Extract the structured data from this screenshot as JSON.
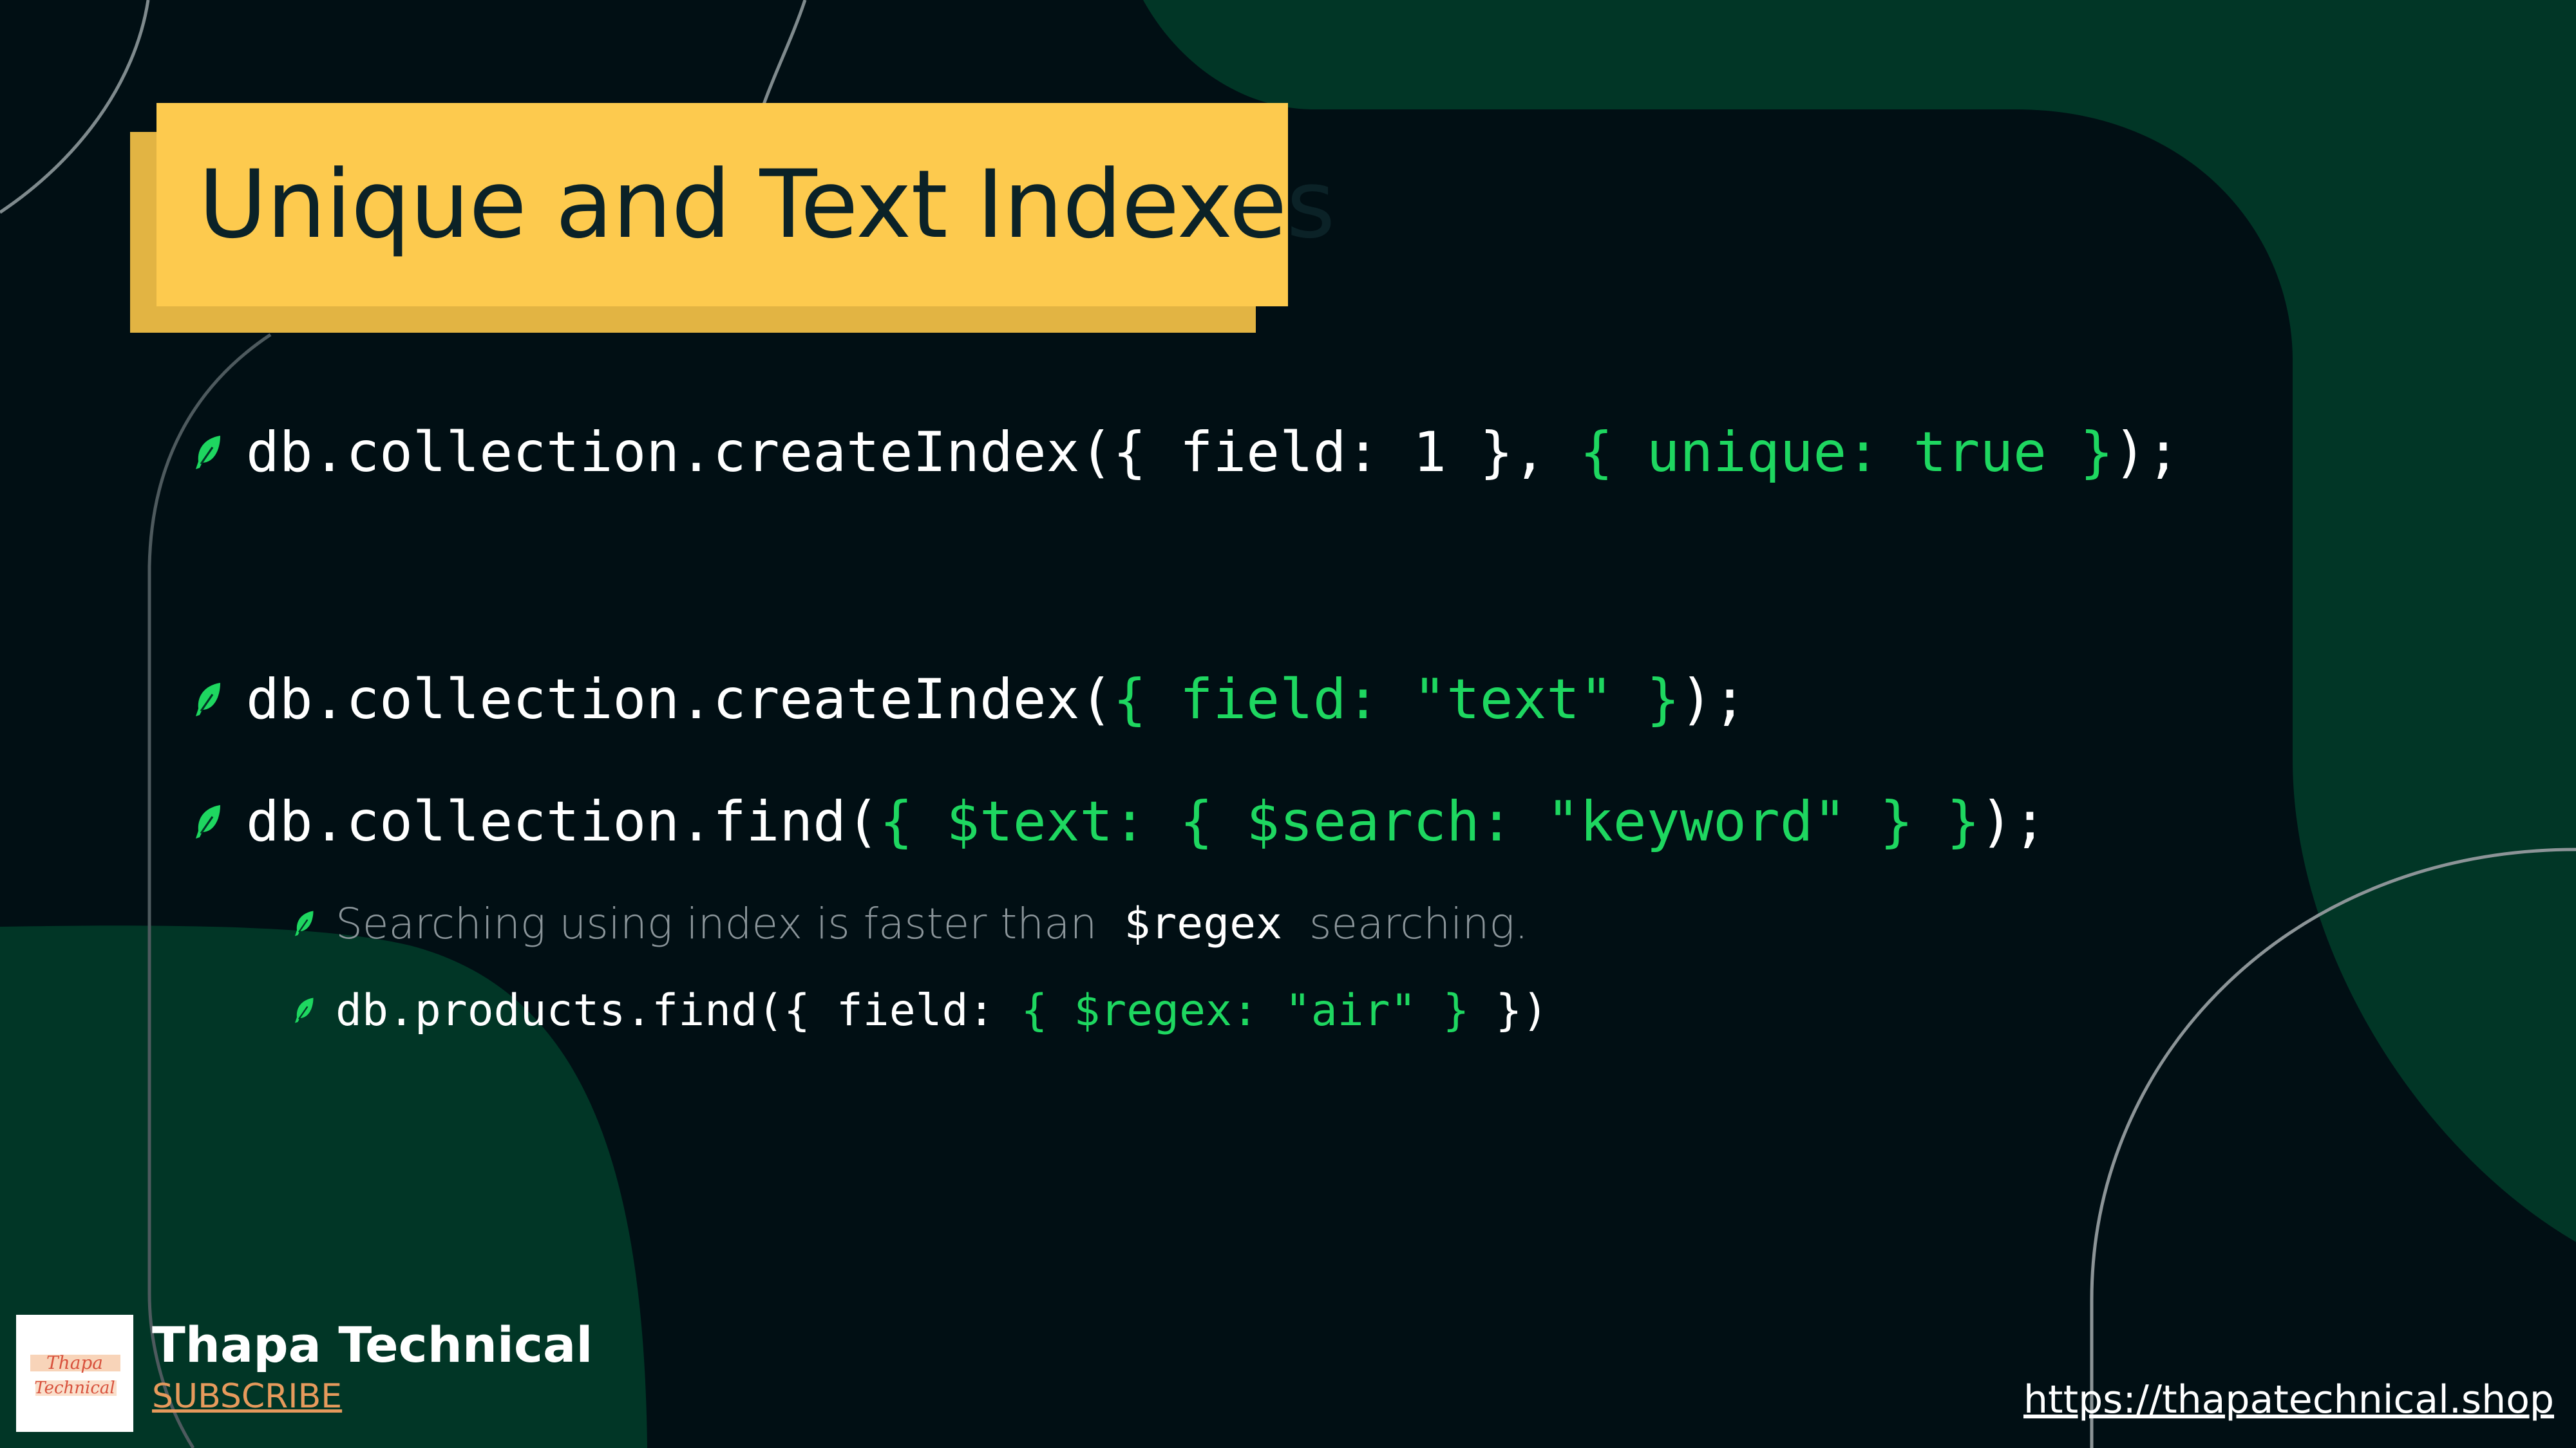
{
  "title": "Unique and Text Indexes",
  "colors": {
    "background": "#010f14",
    "dark_green": "#013626",
    "title_yellow": "#fdca4e",
    "code_green": "#1ed760",
    "code_white": "#ffffff",
    "prose_gray": "#8b959a",
    "subscribe_orange": "#e69a5c"
  },
  "bullet_icon": "leaf-icon",
  "code_lines": [
    {
      "white_prefix": "db.collection.createIndex({ field: 1 },",
      "green_part": " { unique: true }",
      "white_suffix": ");"
    },
    {
      "white_prefix": "db.collection.createIndex(",
      "green_part": "{ field: \"text\" }",
      "white_suffix": ");"
    },
    {
      "white_prefix": "db.collection.find(",
      "green_part": "{ $text: { $search: \"keyword\" } }",
      "white_suffix": ");"
    }
  ],
  "sub_bullets": [
    {
      "text_before": "Searching using index is faster than",
      "code": "$regex",
      "text_after": "searching."
    },
    {
      "white_prefix": "db.products.find({ field: ",
      "green_part": "{ $regex: \"air\" }",
      "white_suffix": " })"
    }
  ],
  "brand": {
    "logo_text_line1": "Thapa",
    "logo_text_line2": "Technical",
    "name": "Thapa Technical",
    "subscribe": "SUBSCRIBE"
  },
  "website": "https://thapatechnical.shop"
}
